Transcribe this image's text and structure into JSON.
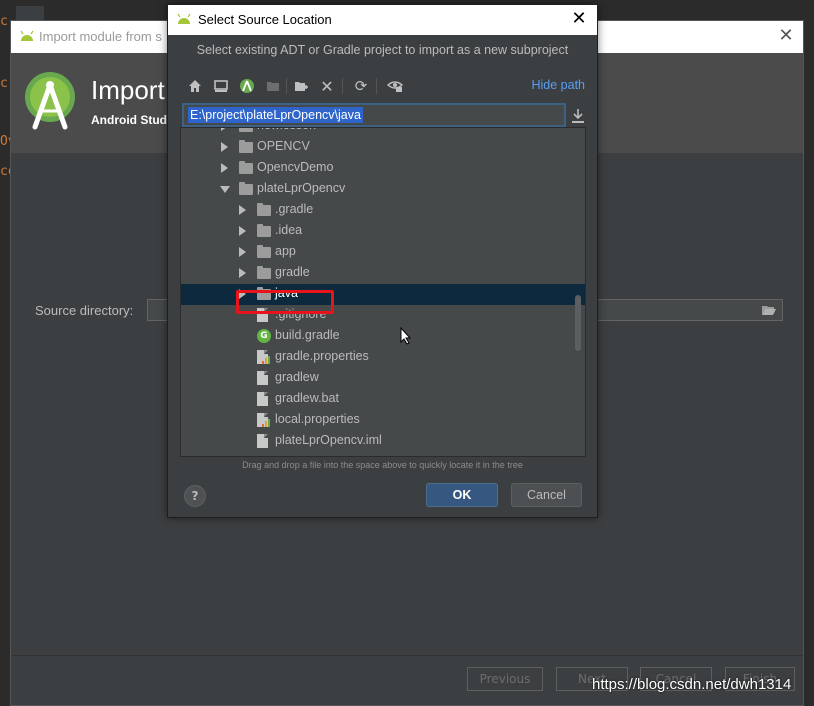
{
  "background": {
    "title": "Import module from s",
    "header_title": "Import",
    "header_subtitle": "Android Stud",
    "source_label": "Source directory:",
    "buttons": {
      "previous": "Previous",
      "next": "Next",
      "cancel": "Cancel",
      "finish": "Finish"
    },
    "left_code": [
      "c",
      "c",
      "Ov",
      "co"
    ]
  },
  "dialog": {
    "title": "Select Source Location",
    "description": "Select existing ADT or Gradle project to import as a new subproject",
    "hide_path": "Hide path",
    "path": "E:\\project\\plateLprOpencv\\java",
    "toolbar_icons": [
      "home-icon",
      "desktop-icon",
      "android-icon",
      "new-folder-icon",
      "delete-icon",
      "refresh-icon",
      "show-hidden-icon"
    ],
    "tree": [
      {
        "label": "newlesson",
        "kind": "folder",
        "depth": 1,
        "arrow": "right"
      },
      {
        "label": "OPENCV",
        "kind": "folder",
        "depth": 1,
        "arrow": "right"
      },
      {
        "label": "OpencvDemo",
        "kind": "folder",
        "depth": 1,
        "arrow": "right"
      },
      {
        "label": "plateLprOpencv",
        "kind": "folder",
        "depth": 1,
        "arrow": "down"
      },
      {
        "label": ".gradle",
        "kind": "folder",
        "depth": 2,
        "arrow": "right"
      },
      {
        "label": ".idea",
        "kind": "folder",
        "depth": 2,
        "arrow": "right"
      },
      {
        "label": "app",
        "kind": "folder",
        "depth": 2,
        "arrow": "right"
      },
      {
        "label": "gradle",
        "kind": "folder",
        "depth": 2,
        "arrow": "right"
      },
      {
        "label": "java",
        "kind": "folder",
        "depth": 2,
        "arrow": "right",
        "selected": true
      },
      {
        "label": ".gitignore",
        "kind": "file",
        "depth": 2
      },
      {
        "label": "build.gradle",
        "kind": "gradle",
        "depth": 2
      },
      {
        "label": "gradle.properties",
        "kind": "props",
        "depth": 2
      },
      {
        "label": "gradlew",
        "kind": "file",
        "depth": 2
      },
      {
        "label": "gradlew.bat",
        "kind": "file",
        "depth": 2
      },
      {
        "label": "local.properties",
        "kind": "props",
        "depth": 2
      },
      {
        "label": "plateLprOpencv.iml",
        "kind": "file",
        "depth": 2
      }
    ],
    "hint": "Drag and drop a file into the space above to quickly locate it in the tree",
    "help": "?",
    "ok": "OK",
    "cancel": "Cancel"
  },
  "watermark": "https://blog.csdn.net/dwh1314",
  "colors": {
    "accent": "#589df6",
    "selection": "#0d293e",
    "ok_button": "#365880",
    "highlight_box": "#e8141b",
    "android_green": "#a4c639"
  }
}
